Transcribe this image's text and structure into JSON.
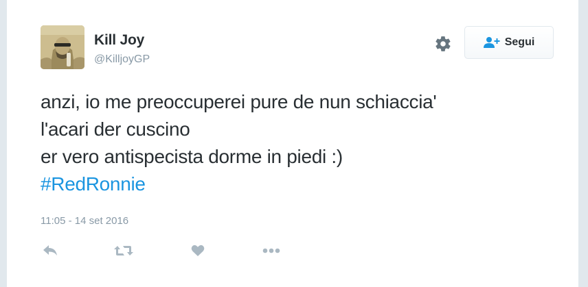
{
  "user": {
    "name": "Kill Joy",
    "handle": "@KilljoyGP"
  },
  "header": {
    "follow_label": "Segui",
    "settings_icon": "gear-icon",
    "follow_icon": "follow-user-icon"
  },
  "tweet": {
    "lines": [
      "anzi, io me preoccuperei pure de nun schiaccia'",
      "l'acari der cuscino",
      "er vero antispecista dorme in piedi :)"
    ],
    "hashtag": "#RedRonnie",
    "timestamp": "11:05 - 14 set 2016"
  },
  "actions": {
    "icons": [
      "reply-icon",
      "retweet-icon",
      "like-icon",
      "more-icon"
    ]
  },
  "colors": {
    "text": "#292f33",
    "muted": "#8899a6",
    "link": "#1b95e0",
    "icon": "#aab8c2",
    "border": "#e1e8ed"
  }
}
